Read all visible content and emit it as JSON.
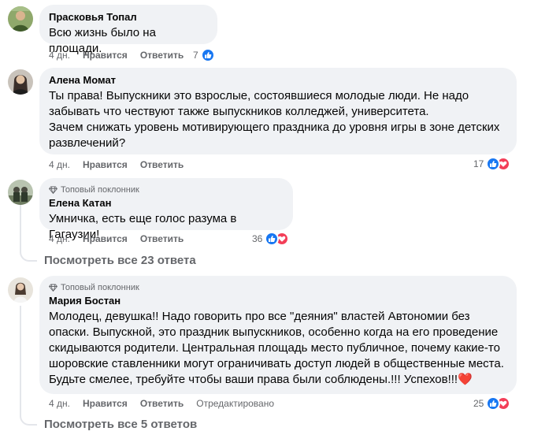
{
  "comments": [
    {
      "author": "Прасковья Топал",
      "badge": "",
      "lines": [
        "Всю жизнь было на площади."
      ],
      "time": "4 дн.",
      "like_label": "Нравится",
      "reply_label": "Ответить",
      "edited_label": "",
      "reactions_count": "7",
      "reactions": [
        "like"
      ]
    },
    {
      "author": "Алена Момат",
      "badge": "",
      "lines": [
        "Ты права! Выпускники это взрослые, состоявшиеся молодые люди. Не надо",
        "забывать что чествуют также выпускников колледжей, университета.",
        "Зачем снижать уровень мотивирующего праздника до уровня игры в зоне детских",
        "развлечений?"
      ],
      "time": "4 дн.",
      "like_label": "Нравится",
      "reply_label": "Ответить",
      "edited_label": "",
      "reactions_count": "17",
      "reactions": [
        "like",
        "love"
      ]
    },
    {
      "author": "Елена Катан",
      "badge": "Топовый поклонник",
      "lines": [
        "Умничка, есть еще голос разума в Гагаузии!"
      ],
      "time": "4 дн.",
      "like_label": "Нравится",
      "reply_label": "Ответить",
      "edited_label": "",
      "reactions_count": "36",
      "reactions": [
        "like",
        "love"
      ],
      "view_replies": "Посмотреть все 23 ответа"
    },
    {
      "author": "Мария Бостан",
      "badge": "Топовый поклонник",
      "lines": [
        "Молодец, девушка!! Надо говорить про все \"деяния\" властей Автономии без",
        "опаски. Выпускной, это праздник выпускников, особенно когда на его проведение",
        "скидываются родители. Центральная площадь место публичное, почему какие-то",
        "шоровские ставленники могут ограничивать доступ людей в общественные места.",
        "Будьте смелее, требуйте чтобы ваши права были соблюдены.!!! Успехов!!!❤️"
      ],
      "time": "4 дн.",
      "like_label": "Нравится",
      "reply_label": "Ответить",
      "edited_label": "Отредактировано",
      "reactions_count": "25",
      "reactions": [
        "like",
        "love"
      ],
      "view_replies": "Посмотреть все 5 ответов"
    }
  ],
  "colors": {
    "bubble": "#f0f2f5",
    "meta_text": "#65676b",
    "like_blue": "#1877f2",
    "love_red": "#f33e58"
  },
  "icons": {
    "top_fan": "diamond-badge-icon",
    "like": "thumbs-up-icon",
    "love": "heart-icon"
  }
}
